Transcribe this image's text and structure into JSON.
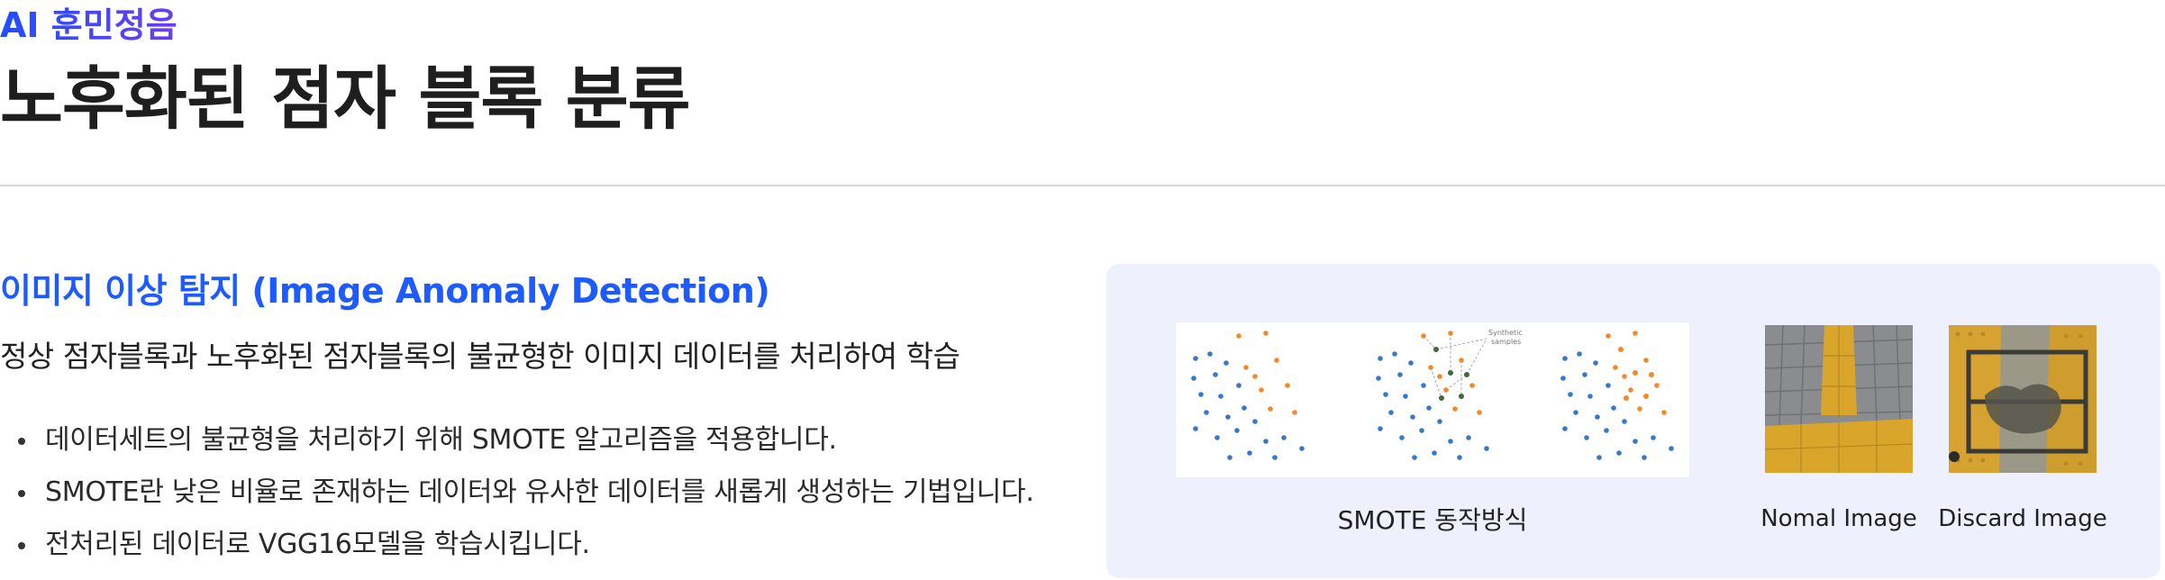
{
  "header": {
    "brand": "AI 훈민정음",
    "title": "노후화된 점자 블록 분류"
  },
  "section": {
    "title": "이미지 이상 탐지 (Image Anomaly Detection)",
    "subtitle": "정상 점자블록과 노후화된 점자블록의 불균형한 이미지 데이터를 처리하여 학습",
    "bullets": [
      "데이터세트의 불균형을 처리하기 위해 SMOTE 알고리즘을 적용합니다.",
      "SMOTE란 낮은 비율로 존재하는 데이터와 유사한 데이터를 새롭게 생성하는 기법입니다.",
      "전처리된 데이터로 VGG16모델을 학습시킵니다."
    ]
  },
  "figures": {
    "smote": {
      "caption": "SMOTE 동작방식",
      "annotation": [
        "Synthetic",
        "samples"
      ],
      "colors": {
        "majority": "#3a78c2",
        "minority": "#f08a2c",
        "synthetic": "#3f6b3a"
      }
    },
    "normal_caption": "Nomal Image",
    "discard_caption": "Discard Image"
  }
}
